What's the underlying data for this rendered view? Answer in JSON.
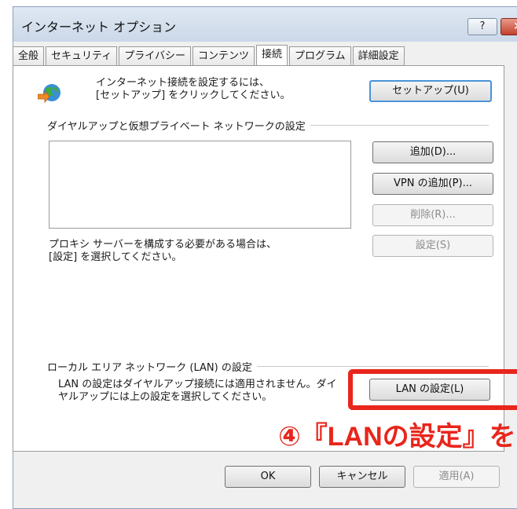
{
  "window": {
    "title": "インターネット オプション",
    "help_label": "?",
    "close_label": "✕"
  },
  "tabs": [
    {
      "label": "全般"
    },
    {
      "label": "セキュリティ"
    },
    {
      "label": "プライバシー"
    },
    {
      "label": "コンテンツ"
    },
    {
      "label": "接続",
      "active": true
    },
    {
      "label": "プログラム"
    },
    {
      "label": "詳細設定"
    }
  ],
  "setup": {
    "text": "インターネット接続を設定するには、\n[セットアップ] をクリックしてください。",
    "button": "セットアップ(U)"
  },
  "dialup": {
    "group_label": "ダイヤルアップと仮想プライベート ネットワークの設定",
    "add_button": "追加(D)...",
    "add_vpn_button": "VPN の追加(P)...",
    "delete_button": "削除(R)...",
    "settings_button": "設定(S)",
    "proxy_text": "プロキシ サーバーを構成する必要がある場合は、\n[設定] を選択してください。"
  },
  "lan": {
    "group_label": "ローカル エリア ネットワーク (LAN) の設定",
    "description": "LAN の設定はダイヤルアップ接続には適用されません。ダイ\nヤルアップには上の設定を選択してください。",
    "button": "LAN の設定(L)"
  },
  "annotation": {
    "text": "④『LANの設定』を"
  },
  "footer": {
    "ok": "OK",
    "cancel": "キャンセル",
    "apply": "適用(A)"
  },
  "colors": {
    "annotation": "#e8261c",
    "default_button_border": "#4a93d8"
  },
  "icons": {
    "setup": "globe-connect-icon"
  }
}
